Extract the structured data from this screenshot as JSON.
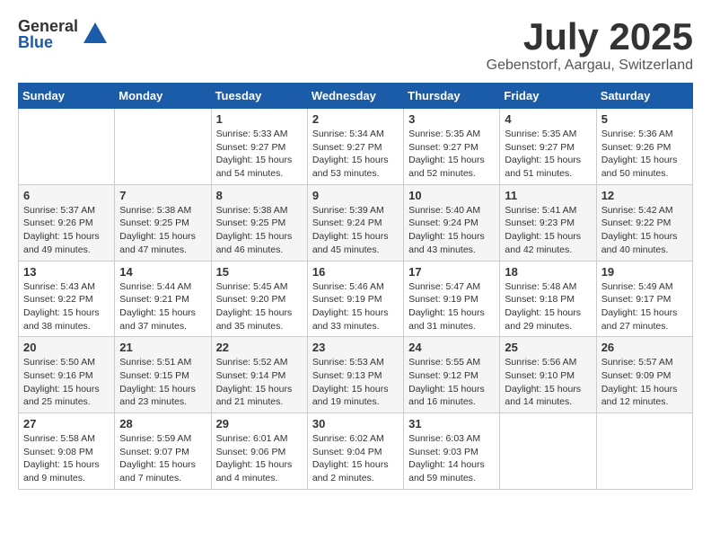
{
  "logo": {
    "general": "General",
    "blue": "Blue"
  },
  "title": "July 2025",
  "location": "Gebenstorf, Aargau, Switzerland",
  "days_of_week": [
    "Sunday",
    "Monday",
    "Tuesday",
    "Wednesday",
    "Thursday",
    "Friday",
    "Saturday"
  ],
  "weeks": [
    [
      {
        "day": "",
        "info": ""
      },
      {
        "day": "",
        "info": ""
      },
      {
        "day": "1",
        "info": "Sunrise: 5:33 AM\nSunset: 9:27 PM\nDaylight: 15 hours\nand 54 minutes."
      },
      {
        "day": "2",
        "info": "Sunrise: 5:34 AM\nSunset: 9:27 PM\nDaylight: 15 hours\nand 53 minutes."
      },
      {
        "day": "3",
        "info": "Sunrise: 5:35 AM\nSunset: 9:27 PM\nDaylight: 15 hours\nand 52 minutes."
      },
      {
        "day": "4",
        "info": "Sunrise: 5:35 AM\nSunset: 9:27 PM\nDaylight: 15 hours\nand 51 minutes."
      },
      {
        "day": "5",
        "info": "Sunrise: 5:36 AM\nSunset: 9:26 PM\nDaylight: 15 hours\nand 50 minutes."
      }
    ],
    [
      {
        "day": "6",
        "info": "Sunrise: 5:37 AM\nSunset: 9:26 PM\nDaylight: 15 hours\nand 49 minutes."
      },
      {
        "day": "7",
        "info": "Sunrise: 5:38 AM\nSunset: 9:25 PM\nDaylight: 15 hours\nand 47 minutes."
      },
      {
        "day": "8",
        "info": "Sunrise: 5:38 AM\nSunset: 9:25 PM\nDaylight: 15 hours\nand 46 minutes."
      },
      {
        "day": "9",
        "info": "Sunrise: 5:39 AM\nSunset: 9:24 PM\nDaylight: 15 hours\nand 45 minutes."
      },
      {
        "day": "10",
        "info": "Sunrise: 5:40 AM\nSunset: 9:24 PM\nDaylight: 15 hours\nand 43 minutes."
      },
      {
        "day": "11",
        "info": "Sunrise: 5:41 AM\nSunset: 9:23 PM\nDaylight: 15 hours\nand 42 minutes."
      },
      {
        "day": "12",
        "info": "Sunrise: 5:42 AM\nSunset: 9:22 PM\nDaylight: 15 hours\nand 40 minutes."
      }
    ],
    [
      {
        "day": "13",
        "info": "Sunrise: 5:43 AM\nSunset: 9:22 PM\nDaylight: 15 hours\nand 38 minutes."
      },
      {
        "day": "14",
        "info": "Sunrise: 5:44 AM\nSunset: 9:21 PM\nDaylight: 15 hours\nand 37 minutes."
      },
      {
        "day": "15",
        "info": "Sunrise: 5:45 AM\nSunset: 9:20 PM\nDaylight: 15 hours\nand 35 minutes."
      },
      {
        "day": "16",
        "info": "Sunrise: 5:46 AM\nSunset: 9:19 PM\nDaylight: 15 hours\nand 33 minutes."
      },
      {
        "day": "17",
        "info": "Sunrise: 5:47 AM\nSunset: 9:19 PM\nDaylight: 15 hours\nand 31 minutes."
      },
      {
        "day": "18",
        "info": "Sunrise: 5:48 AM\nSunset: 9:18 PM\nDaylight: 15 hours\nand 29 minutes."
      },
      {
        "day": "19",
        "info": "Sunrise: 5:49 AM\nSunset: 9:17 PM\nDaylight: 15 hours\nand 27 minutes."
      }
    ],
    [
      {
        "day": "20",
        "info": "Sunrise: 5:50 AM\nSunset: 9:16 PM\nDaylight: 15 hours\nand 25 minutes."
      },
      {
        "day": "21",
        "info": "Sunrise: 5:51 AM\nSunset: 9:15 PM\nDaylight: 15 hours\nand 23 minutes."
      },
      {
        "day": "22",
        "info": "Sunrise: 5:52 AM\nSunset: 9:14 PM\nDaylight: 15 hours\nand 21 minutes."
      },
      {
        "day": "23",
        "info": "Sunrise: 5:53 AM\nSunset: 9:13 PM\nDaylight: 15 hours\nand 19 minutes."
      },
      {
        "day": "24",
        "info": "Sunrise: 5:55 AM\nSunset: 9:12 PM\nDaylight: 15 hours\nand 16 minutes."
      },
      {
        "day": "25",
        "info": "Sunrise: 5:56 AM\nSunset: 9:10 PM\nDaylight: 15 hours\nand 14 minutes."
      },
      {
        "day": "26",
        "info": "Sunrise: 5:57 AM\nSunset: 9:09 PM\nDaylight: 15 hours\nand 12 minutes."
      }
    ],
    [
      {
        "day": "27",
        "info": "Sunrise: 5:58 AM\nSunset: 9:08 PM\nDaylight: 15 hours\nand 9 minutes."
      },
      {
        "day": "28",
        "info": "Sunrise: 5:59 AM\nSunset: 9:07 PM\nDaylight: 15 hours\nand 7 minutes."
      },
      {
        "day": "29",
        "info": "Sunrise: 6:01 AM\nSunset: 9:06 PM\nDaylight: 15 hours\nand 4 minutes."
      },
      {
        "day": "30",
        "info": "Sunrise: 6:02 AM\nSunset: 9:04 PM\nDaylight: 15 hours\nand 2 minutes."
      },
      {
        "day": "31",
        "info": "Sunrise: 6:03 AM\nSunset: 9:03 PM\nDaylight: 14 hours\nand 59 minutes."
      },
      {
        "day": "",
        "info": ""
      },
      {
        "day": "",
        "info": ""
      }
    ]
  ]
}
